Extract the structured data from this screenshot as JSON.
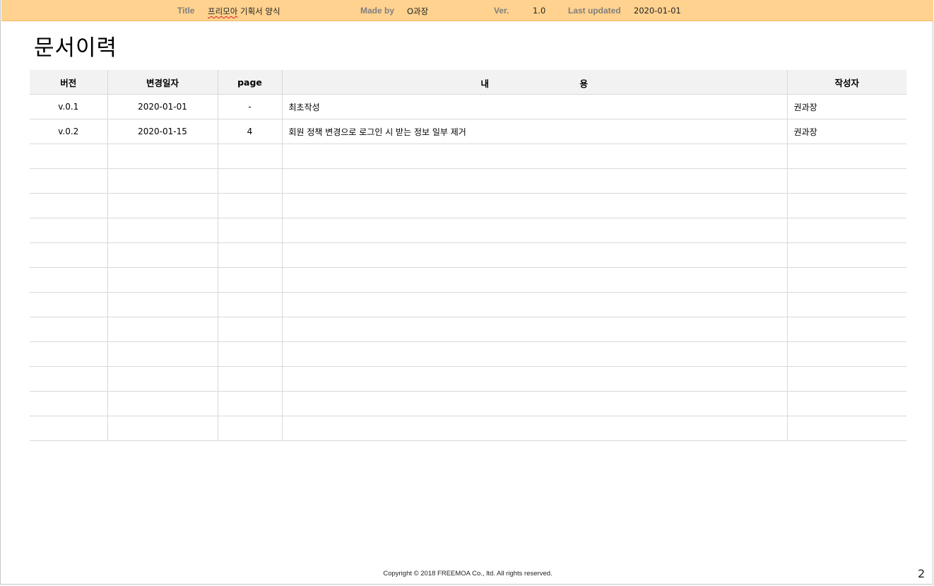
{
  "header": {
    "title_label": "Title",
    "title_value": "프리모아 기획서 양식",
    "title_value_first": "프리모아",
    "title_value_rest": "기획서 양식",
    "made_by_label": "Made by",
    "made_by_value": "O과장",
    "ver_label": "Ver.",
    "ver_value": "1.0",
    "updated_label": "Last updated",
    "updated_value": "2020-01-01"
  },
  "page_title": "문서이력",
  "table": {
    "columns": {
      "version": "버전",
      "date": "변경일자",
      "page": "page",
      "content_1": "내",
      "content_2": "용",
      "author": "작성자"
    },
    "rows": [
      {
        "version": "v.0.1",
        "date": "2020-01-01",
        "page": "-",
        "content": "최초작성",
        "author": "권과장"
      },
      {
        "version": "v.0.2",
        "date": "2020-01-15",
        "page": "4",
        "content": "회원 정책 변경으로 로그인 시 받는 정보 일부 제거",
        "author": "권과장"
      }
    ],
    "empty_row_count": 12
  },
  "footer": {
    "copyright": "Copyright © 2018 FREEMOA Co., ltd. All rights reserved.",
    "page_number": "2"
  }
}
